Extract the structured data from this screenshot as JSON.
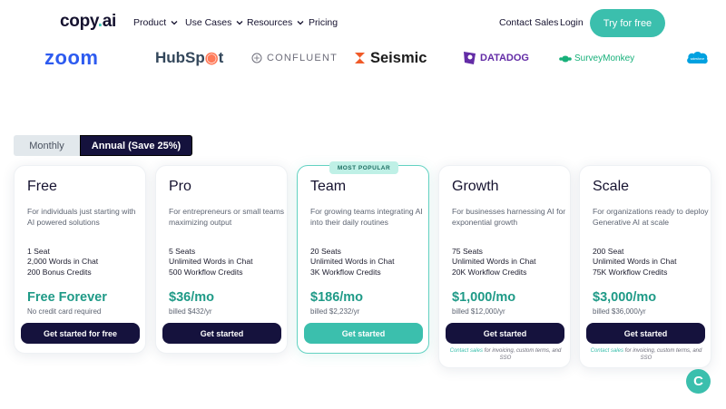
{
  "nav": {
    "logo": "copy",
    "logo_suffix": "ai",
    "items": [
      "Product",
      "Use Cases",
      "Resources",
      "Pricing"
    ],
    "contact_sales": "Contact Sales",
    "login": "Login",
    "try_free": "Try for free"
  },
  "logos": {
    "zoom": "zoom",
    "hubspot_a": "HubSp",
    "hubspot_b": "t",
    "confluent": "CONFLUENT",
    "seismic": "Seismic",
    "datadog": "DATADOG",
    "surveymonkey": "SurveyMonkey",
    "salesforce": "salesforce"
  },
  "billing_toggle": {
    "monthly": "Monthly",
    "annual": "Annual (Save 25%)",
    "selected": "annual"
  },
  "plans": [
    {
      "name": "Free",
      "description": "For individuals just starting with AI powered solutions",
      "features": [
        "1 Seat",
        "2,000 Words in Chat",
        "200 Bonus Credits"
      ],
      "price": "Free Forever",
      "billed": "No credit card required",
      "cta": "Get started for free"
    },
    {
      "name": "Pro",
      "description": "For entrepreneurs or small teams maximizing output",
      "features": [
        "5 Seats",
        "Unlimited Words in Chat",
        "500 Workflow Credits"
      ],
      "price": "$36/mo",
      "billed": "billed $432/yr",
      "cta": "Get started"
    },
    {
      "name": "Team",
      "badge": "MOST POPULAR",
      "description": "For growing teams integrating AI into their daily routines",
      "features": [
        "20 Seats",
        "Unlimited Words in Chat",
        "3K Workflow Credits"
      ],
      "price": "$186/mo",
      "billed": "billed $2,232/yr",
      "cta": "Get started"
    },
    {
      "name": "Growth",
      "description": "For businesses harnessing AI for exponential growth",
      "features": [
        "75 Seats",
        "Unlimited Words in Chat",
        "20K Workflow Credits"
      ],
      "price": "$1,000/mo",
      "billed": "billed $12,000/yr",
      "cta": "Get started",
      "note_link": "Contact sales",
      "note_text": " for invoicing, custom terms, and SSO"
    },
    {
      "name": "Scale",
      "description": "For organizations ready to deploy Generative AI at scale",
      "features": [
        "200 Seat",
        "Unlimited Words in Chat",
        "75K Workflow Credits"
      ],
      "price": "$3,000/mo",
      "billed": "billed $36,000/yr",
      "cta": "Get started",
      "note_link": "Contact sales",
      "note_text": " for invoicing, custom terms, and SSO"
    }
  ],
  "chat_widget": "C",
  "colors": {
    "accent": "#3bbfad",
    "navy": "#15123d",
    "price": "#1f9a87",
    "zoom": "#2d5bf0",
    "hubspot_orange": "#ff7a59",
    "datadog": "#632ca6",
    "surveymonkey": "#17b07a",
    "salesforce": "#00a1e0"
  }
}
